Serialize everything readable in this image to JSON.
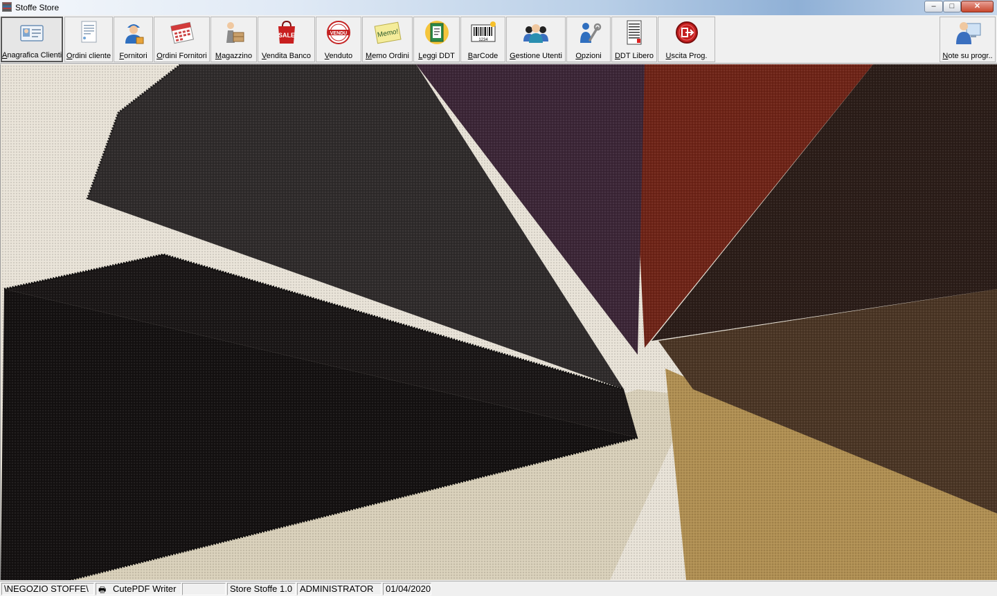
{
  "window": {
    "title": "Stoffe Store",
    "minimize_label": "–",
    "maximize_label": "□",
    "close_label": "✕"
  },
  "toolbar": {
    "buttons": [
      {
        "label": "Anagrafica Clienti",
        "icon": "client-card-icon"
      },
      {
        "label": "Ordini cliente",
        "icon": "order-document-icon"
      },
      {
        "label": "Fornitori",
        "icon": "supplier-person-icon"
      },
      {
        "label": "Ordini Fornitori",
        "icon": "calendar-icon"
      },
      {
        "label": "Magazzino",
        "icon": "warehouse-worker-icon"
      },
      {
        "label": "Vendita Banco",
        "icon": "sale-bag-icon"
      },
      {
        "label": "Venduto",
        "icon": "sold-stamp-icon"
      },
      {
        "label": "Memo Ordini",
        "icon": "memo-note-icon"
      },
      {
        "label": "Leggi DDT",
        "icon": "ddt-document-icon"
      },
      {
        "label": "BarCode",
        "icon": "barcode-icon"
      },
      {
        "label": "Gestione Utenti",
        "icon": "users-group-icon"
      },
      {
        "label": "Opzioni",
        "icon": "wrench-person-icon"
      },
      {
        "label": "DDT Libero",
        "icon": "ddt-sheet-icon"
      },
      {
        "label": "Uscita Prog.",
        "icon": "exit-icon"
      },
      {
        "label": "Note su progr..",
        "icon": "user-computer-icon"
      }
    ],
    "icon_text": {
      "sale": "SALE",
      "venduto_stamp": "VENDU",
      "memo": "Memo!",
      "barcode_digits": "1234"
    }
  },
  "statusbar": {
    "path": "\\NEGOZIO STOFFE\\",
    "printer": "CutePDF Writer",
    "empty": "",
    "version": "Store Stoffe 1.0",
    "user": "ADMINISTRATOR",
    "date": "01/04/2020"
  },
  "colors": {
    "fabric_black": "#141111",
    "fabric_charcoal": "#2e2a2a",
    "fabric_purple": "#3b2536",
    "fabric_red": "#6e2416",
    "fabric_dark_brown": "#2a1c17",
    "fabric_brown": "#4a3524",
    "fabric_tan": "#a8884c",
    "fabric_cream": "#d8cfb9"
  }
}
